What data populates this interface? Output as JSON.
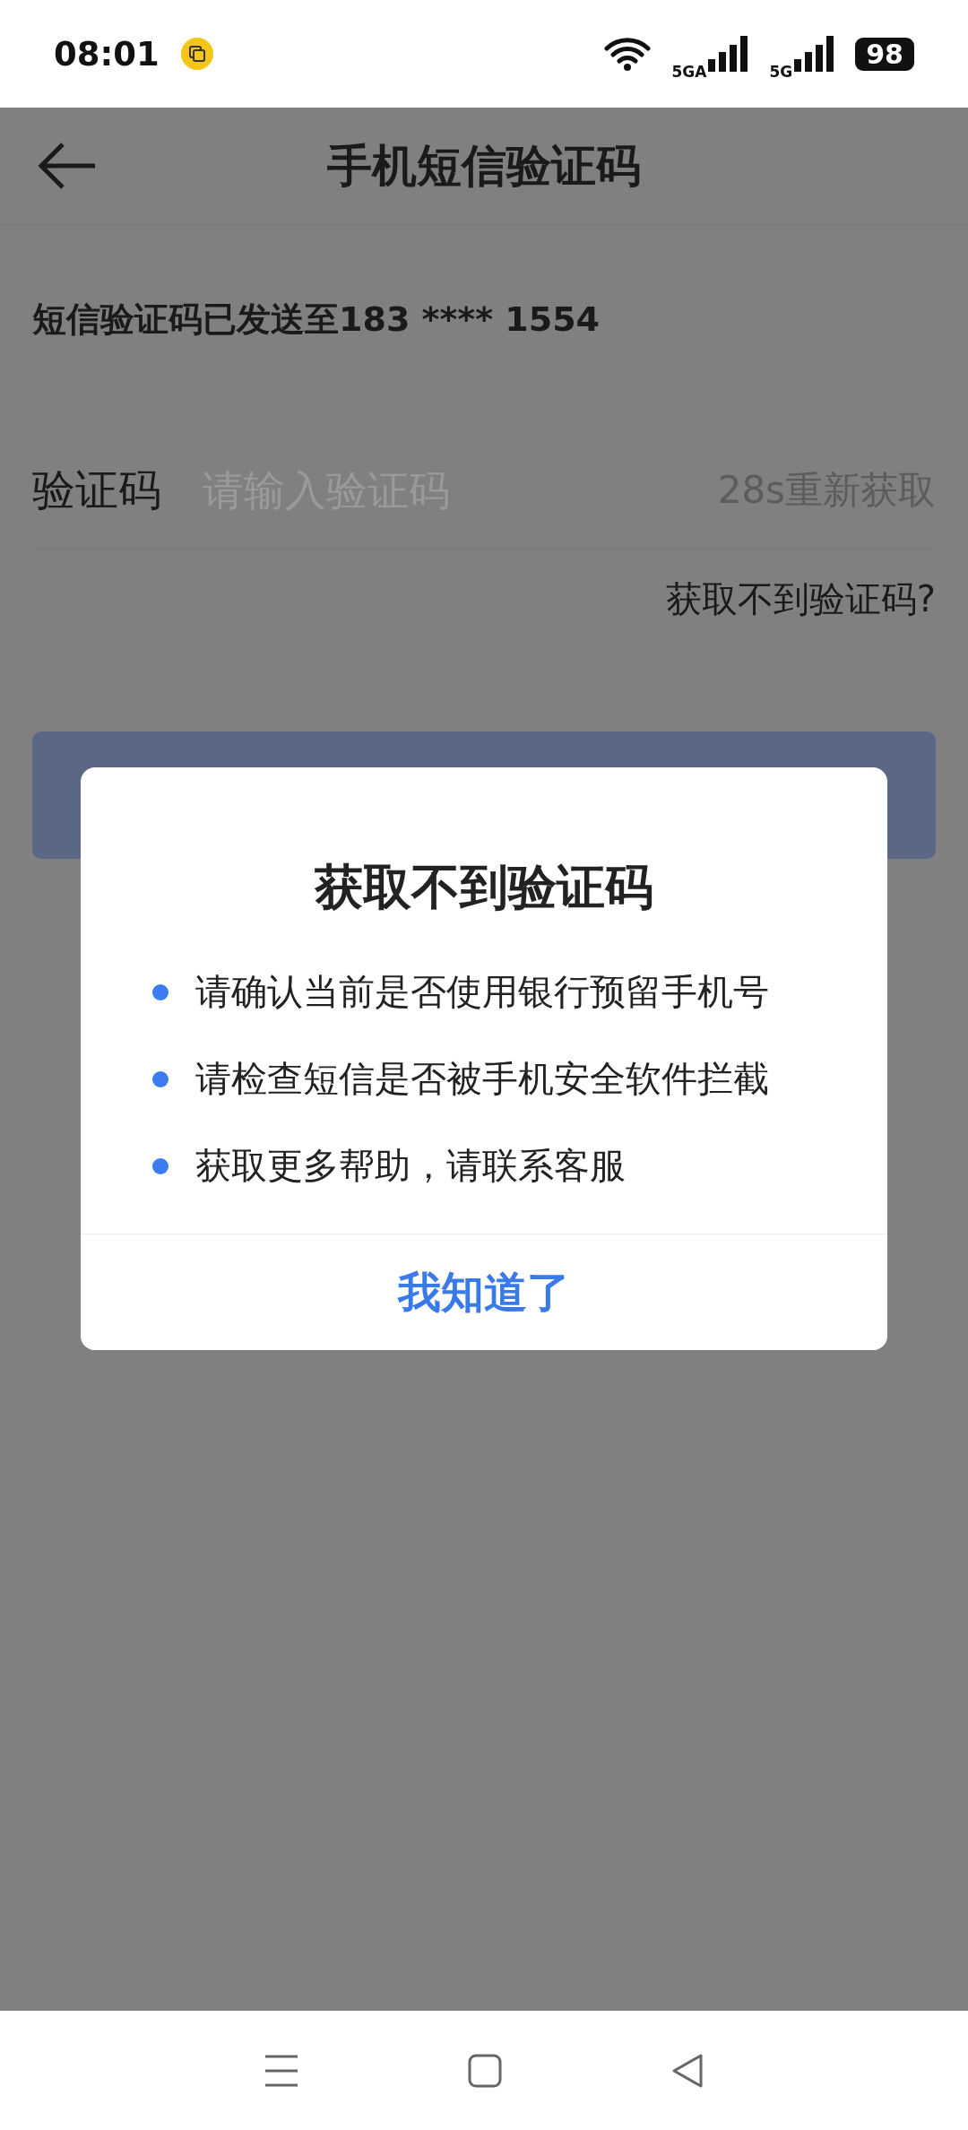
{
  "status_bar": {
    "time": "08:01",
    "network_1": "5GA",
    "network_2": "5G",
    "battery": "98"
  },
  "header": {
    "title": "手机短信验证码"
  },
  "sent_message": "短信验证码已发送至183 **** 1554",
  "code_field": {
    "label": "验证码",
    "placeholder": "请输入验证码",
    "resend": "28s重新获取"
  },
  "help_link": "获取不到验证码?",
  "dialog": {
    "title": "获取不到验证码",
    "items": [
      "请确认当前是否使用银行预留手机号",
      "请检查短信是否被手机安全软件拦截",
      "获取更多帮助，请联系客服"
    ],
    "confirm": "我知道了"
  }
}
